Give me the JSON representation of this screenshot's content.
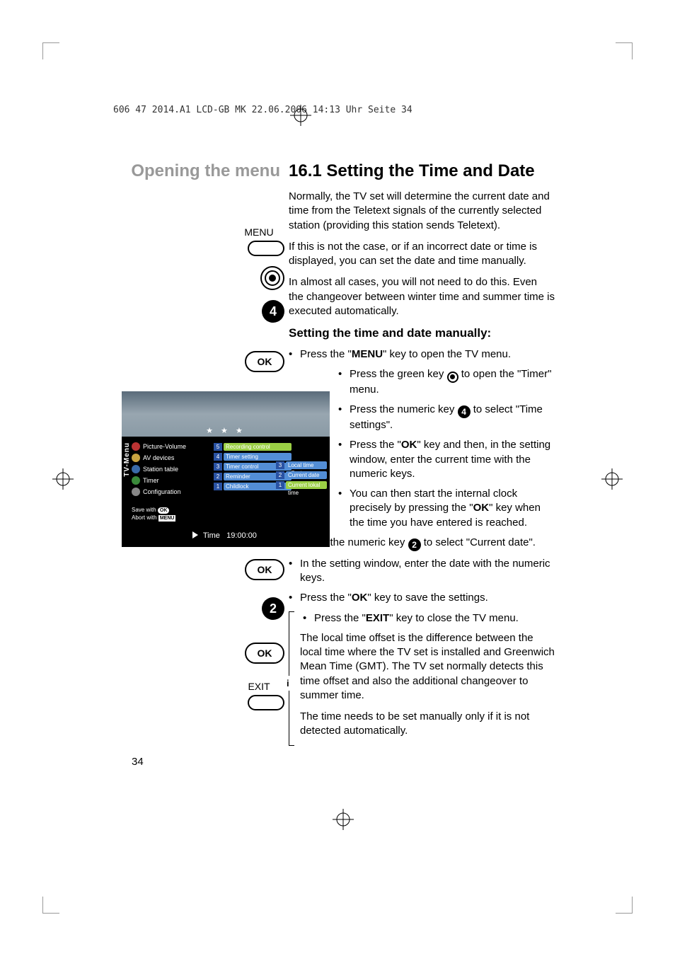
{
  "header": "606 47 2014.A1 LCD-GB  MK  22.06.2006  14:13 Uhr  Seite 34",
  "title_left": "Opening the menu",
  "title_right": "16.1 Setting the Time and Date",
  "para1": "Normally, the TV set will determine the current date and time from the Teletext signals of the currently selected station (providing this station sends Teletext).",
  "para2": "If this is not the case, or if an incorrect date or time is displayed, you can set the date and time manually.",
  "para3": "In almost all cases, you will not need to do this. Even the changeover between winter time and summer time is executed automatically.",
  "subhead": "Setting the time and date manually:",
  "b1_pre": "Press the \"",
  "b1_bold": "MENU",
  "b1_post": "\" key to open the TV menu.",
  "b2_pre": "Press the green key ",
  "b2_post": " to open the \"Timer\" menu.",
  "b3_pre": "Press the numeric key ",
  "b3_num": "4",
  "b3_post": " to select \"Time settings\".",
  "b4_pre": "Press the \"",
  "b4_bold": "OK",
  "b4_post": "\" key and then, in the setting window, enter the current time with the numeric keys.",
  "b5_pre": "You can then start the internal clock precisely by pressing the \"",
  "b5_bold": "OK",
  "b5_post": "\" key when the time you have entered is reached.",
  "b6_pre": "Press the numeric key ",
  "b6_num": "2",
  "b6_post": " to select \"Current date\".",
  "b7": "In the setting window, enter the date with the numeric keys.",
  "b8_pre": "Press the \"",
  "b8_bold": "OK",
  "b8_post": "\" key to save the settings.",
  "b9_pre": "Press the \"",
  "b9_bold": "EXIT",
  "b9_post": "\" key to close the TV menu.",
  "info1": "The local time offset is the difference between the local time where the TV set is installed and Greenwich Mean Time (GMT). The TV set normally detects this time offset and also the additional changeover to summer time.",
  "info2": "The time needs to be set manually only if it is not detected automatically.",
  "remote": {
    "menu": "MENU",
    "ok": "OK",
    "num4": "4",
    "num2": "2",
    "exit": "EXIT"
  },
  "osd": {
    "vert": "TV-Menu",
    "left": [
      "Picture-Volume",
      "AV devices",
      "Station table",
      "Timer",
      "Configuration"
    ],
    "mid": [
      {
        "n": "5",
        "t": "Recording control"
      },
      {
        "n": "4",
        "t": "Timer setting"
      },
      {
        "n": "3",
        "t": "Timer control"
      },
      {
        "n": "2",
        "t": "Reminder"
      },
      {
        "n": "1",
        "t": "Childlock"
      }
    ],
    "right": [
      {
        "n": "3",
        "t": "Local time offset"
      },
      {
        "n": "2",
        "t": "Current date"
      },
      {
        "n": "1",
        "t": "Current lokal time"
      }
    ],
    "save_with": "Save with",
    "save_ok": "OK",
    "abort_with": "Abort with",
    "abort_menu": "MENU",
    "time_label": "Time",
    "time_value": "19:00:00"
  },
  "pagenum": "34"
}
